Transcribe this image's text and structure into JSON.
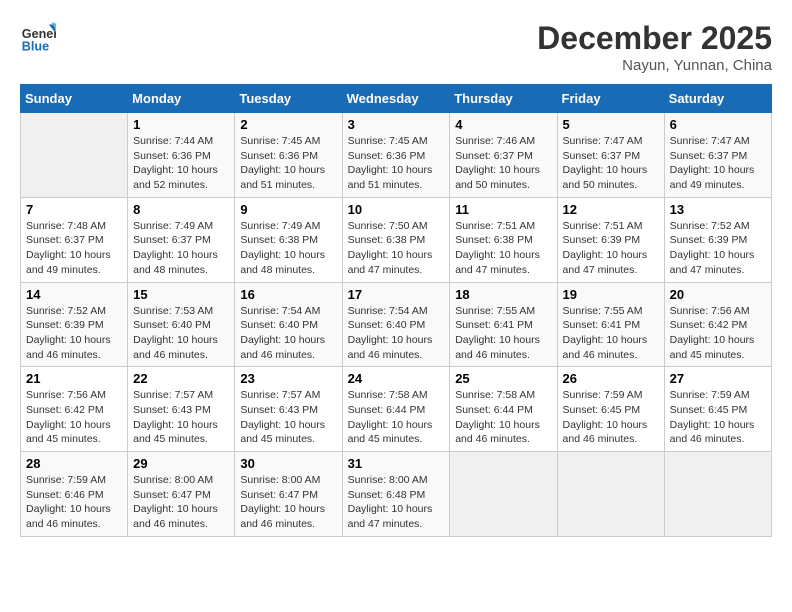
{
  "header": {
    "logo_line1": "General",
    "logo_line2": "Blue",
    "month": "December 2025",
    "location": "Nayun, Yunnan, China"
  },
  "weekdays": [
    "Sunday",
    "Monday",
    "Tuesday",
    "Wednesday",
    "Thursday",
    "Friday",
    "Saturday"
  ],
  "weeks": [
    [
      {
        "day": "",
        "sunrise": "",
        "sunset": "",
        "daylight": ""
      },
      {
        "day": "1",
        "sunrise": "7:44 AM",
        "sunset": "6:36 PM",
        "daylight": "10 hours and 52 minutes."
      },
      {
        "day": "2",
        "sunrise": "7:45 AM",
        "sunset": "6:36 PM",
        "daylight": "10 hours and 51 minutes."
      },
      {
        "day": "3",
        "sunrise": "7:45 AM",
        "sunset": "6:36 PM",
        "daylight": "10 hours and 51 minutes."
      },
      {
        "day": "4",
        "sunrise": "7:46 AM",
        "sunset": "6:37 PM",
        "daylight": "10 hours and 50 minutes."
      },
      {
        "day": "5",
        "sunrise": "7:47 AM",
        "sunset": "6:37 PM",
        "daylight": "10 hours and 50 minutes."
      },
      {
        "day": "6",
        "sunrise": "7:47 AM",
        "sunset": "6:37 PM",
        "daylight": "10 hours and 49 minutes."
      }
    ],
    [
      {
        "day": "7",
        "sunrise": "7:48 AM",
        "sunset": "6:37 PM",
        "daylight": "10 hours and 49 minutes."
      },
      {
        "day": "8",
        "sunrise": "7:49 AM",
        "sunset": "6:37 PM",
        "daylight": "10 hours and 48 minutes."
      },
      {
        "day": "9",
        "sunrise": "7:49 AM",
        "sunset": "6:38 PM",
        "daylight": "10 hours and 48 minutes."
      },
      {
        "day": "10",
        "sunrise": "7:50 AM",
        "sunset": "6:38 PM",
        "daylight": "10 hours and 47 minutes."
      },
      {
        "day": "11",
        "sunrise": "7:51 AM",
        "sunset": "6:38 PM",
        "daylight": "10 hours and 47 minutes."
      },
      {
        "day": "12",
        "sunrise": "7:51 AM",
        "sunset": "6:39 PM",
        "daylight": "10 hours and 47 minutes."
      },
      {
        "day": "13",
        "sunrise": "7:52 AM",
        "sunset": "6:39 PM",
        "daylight": "10 hours and 47 minutes."
      }
    ],
    [
      {
        "day": "14",
        "sunrise": "7:52 AM",
        "sunset": "6:39 PM",
        "daylight": "10 hours and 46 minutes."
      },
      {
        "day": "15",
        "sunrise": "7:53 AM",
        "sunset": "6:40 PM",
        "daylight": "10 hours and 46 minutes."
      },
      {
        "day": "16",
        "sunrise": "7:54 AM",
        "sunset": "6:40 PM",
        "daylight": "10 hours and 46 minutes."
      },
      {
        "day": "17",
        "sunrise": "7:54 AM",
        "sunset": "6:40 PM",
        "daylight": "10 hours and 46 minutes."
      },
      {
        "day": "18",
        "sunrise": "7:55 AM",
        "sunset": "6:41 PM",
        "daylight": "10 hours and 46 minutes."
      },
      {
        "day": "19",
        "sunrise": "7:55 AM",
        "sunset": "6:41 PM",
        "daylight": "10 hours and 46 minutes."
      },
      {
        "day": "20",
        "sunrise": "7:56 AM",
        "sunset": "6:42 PM",
        "daylight": "10 hours and 45 minutes."
      }
    ],
    [
      {
        "day": "21",
        "sunrise": "7:56 AM",
        "sunset": "6:42 PM",
        "daylight": "10 hours and 45 minutes."
      },
      {
        "day": "22",
        "sunrise": "7:57 AM",
        "sunset": "6:43 PM",
        "daylight": "10 hours and 45 minutes."
      },
      {
        "day": "23",
        "sunrise": "7:57 AM",
        "sunset": "6:43 PM",
        "daylight": "10 hours and 45 minutes."
      },
      {
        "day": "24",
        "sunrise": "7:58 AM",
        "sunset": "6:44 PM",
        "daylight": "10 hours and 45 minutes."
      },
      {
        "day": "25",
        "sunrise": "7:58 AM",
        "sunset": "6:44 PM",
        "daylight": "10 hours and 46 minutes."
      },
      {
        "day": "26",
        "sunrise": "7:59 AM",
        "sunset": "6:45 PM",
        "daylight": "10 hours and 46 minutes."
      },
      {
        "day": "27",
        "sunrise": "7:59 AM",
        "sunset": "6:45 PM",
        "daylight": "10 hours and 46 minutes."
      }
    ],
    [
      {
        "day": "28",
        "sunrise": "7:59 AM",
        "sunset": "6:46 PM",
        "daylight": "10 hours and 46 minutes."
      },
      {
        "day": "29",
        "sunrise": "8:00 AM",
        "sunset": "6:47 PM",
        "daylight": "10 hours and 46 minutes."
      },
      {
        "day": "30",
        "sunrise": "8:00 AM",
        "sunset": "6:47 PM",
        "daylight": "10 hours and 46 minutes."
      },
      {
        "day": "31",
        "sunrise": "8:00 AM",
        "sunset": "6:48 PM",
        "daylight": "10 hours and 47 minutes."
      },
      {
        "day": "",
        "sunrise": "",
        "sunset": "",
        "daylight": ""
      },
      {
        "day": "",
        "sunrise": "",
        "sunset": "",
        "daylight": ""
      },
      {
        "day": "",
        "sunrise": "",
        "sunset": "",
        "daylight": ""
      }
    ]
  ]
}
